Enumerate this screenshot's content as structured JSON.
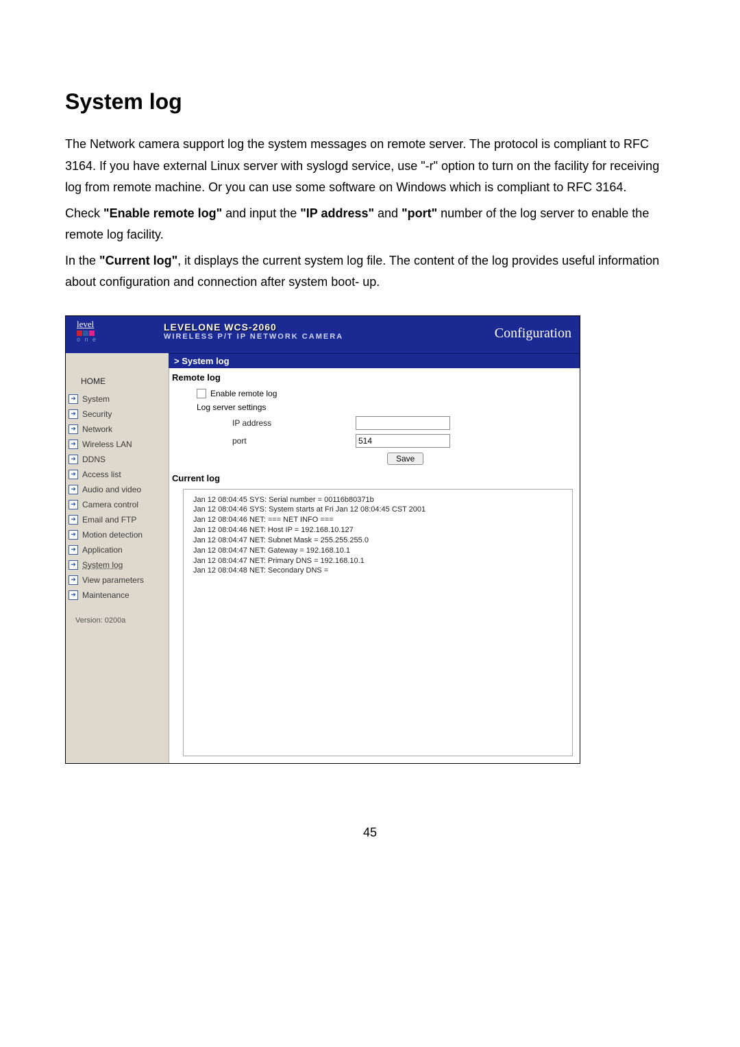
{
  "doc": {
    "title": "System log",
    "para1": "The Network camera support log the system messages on remote server. The protocol is compliant to RFC 3164. If you have external Linux server with syslogd service, use \"-r\" option to turn on the facility for receiving log from remote machine. Or you can use some software on Windows which is compliant to RFC 3164.",
    "para2_pre": "Check ",
    "para2_b1": "\"Enable remote log\"",
    "para2_mid1": " and input the ",
    "para2_b2": "\"IP address\"",
    "para2_mid2": " and ",
    "para2_b3": "\"port\"",
    "para2_post": " number of the log server to enable the remote log facility.",
    "para3_pre": "In the ",
    "para3_b1": "\"Current log\"",
    "para3_post": ", it displays the current system log file. The content of the log provides useful information about configuration and connection after system boot- up.",
    "page_number": "45"
  },
  "ui": {
    "logo_brand": "level",
    "logo_one": "o n e",
    "model": "LEVELONE WCS-2060",
    "subtitle": "WIRELESS P/T IP NETWORK CAMERA",
    "config_label": "Configuration",
    "breadcrumb": "> System log",
    "home": "HOME",
    "nav": [
      "System",
      "Security",
      "Network",
      "Wireless LAN",
      "DDNS",
      "Access list",
      "Audio and video",
      "Camera control",
      "Email and FTP",
      "Motion detection",
      "Application",
      "System log",
      "View parameters",
      "Maintenance"
    ],
    "active_index": 11,
    "version": "Version: 0200a",
    "section_remote": "Remote log",
    "enable_label": "Enable remote log",
    "log_server_label": "Log server settings",
    "ip_label": "IP address",
    "ip_value": "",
    "port_label": "port",
    "port_value": "514",
    "save_label": "Save",
    "section_current": "Current log",
    "log_lines": "Jan 12 08:04:45 SYS: Serial number = 00116b80371b\nJan 12 08:04:46 SYS: System starts at Fri Jan 12 08:04:45 CST 2001\nJan 12 08:04:46 NET: === NET INFO ===\nJan 12 08:04:46 NET: Host IP = 192.168.10.127\nJan 12 08:04:47 NET: Subnet Mask = 255.255.255.0\nJan 12 08:04:47 NET: Gateway = 192.168.10.1\nJan 12 08:04:47 NET: Primary DNS = 192.168.10.1\nJan 12 08:04:48 NET: Secondary DNS ="
  }
}
